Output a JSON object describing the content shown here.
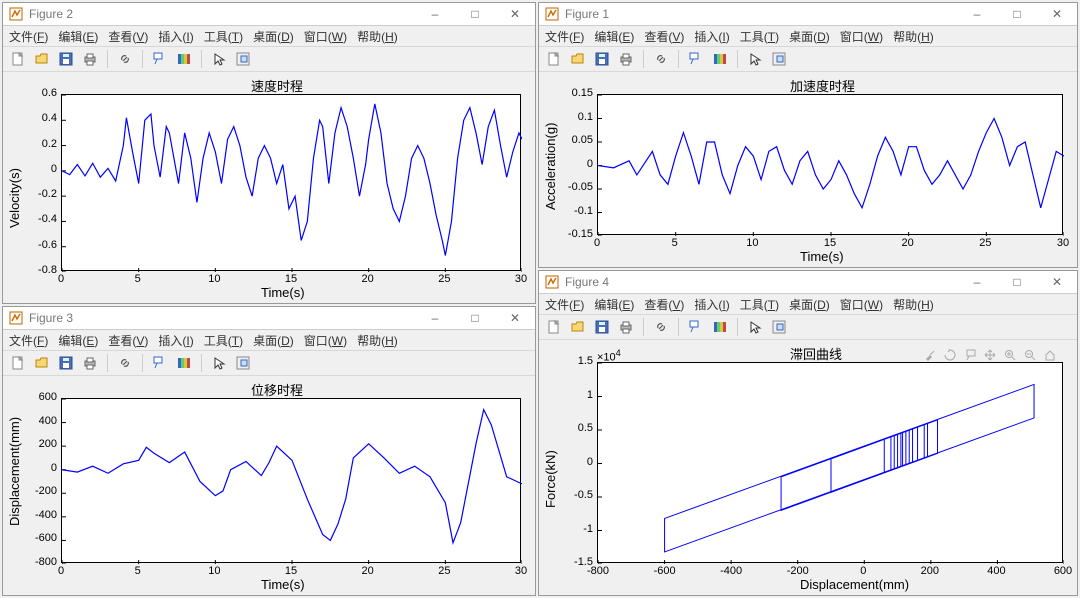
{
  "menus": [
    {
      "label": "文件",
      "ul": "F"
    },
    {
      "label": "编辑",
      "ul": "E"
    },
    {
      "label": "查看",
      "ul": "V"
    },
    {
      "label": "插入",
      "ul": "I"
    },
    {
      "label": "工具",
      "ul": "T"
    },
    {
      "label": "桌面",
      "ul": "D"
    },
    {
      "label": "窗口",
      "ul": "W"
    },
    {
      "label": "帮助",
      "ul": "H"
    }
  ],
  "toolbar_icons": [
    "new",
    "open",
    "save",
    "print",
    "sep",
    "link",
    "sep",
    "datatip",
    "colorbar",
    "sep",
    "pointer",
    "brush"
  ],
  "win_icons": {
    "min": "–",
    "max": "□",
    "close": "✕"
  },
  "axes_toolbar": [
    "brush-icon",
    "rotate-icon",
    "datatip-icon",
    "pan-icon",
    "zoomin-icon",
    "zoomout-icon",
    "home-icon"
  ],
  "figures": {
    "fig1": {
      "window_title": "Figure 1",
      "title": "加速度时程",
      "xlabel": "Time(s)",
      "ylabel": "Acceleration(g)"
    },
    "fig2": {
      "window_title": "Figure 2",
      "title": "速度时程",
      "xlabel": "Time(s)",
      "ylabel": "Velocity(s)"
    },
    "fig3": {
      "window_title": "Figure 3",
      "title": "位移时程",
      "xlabel": "Time(s)",
      "ylabel": "Displacement(mm)"
    },
    "fig4": {
      "window_title": "Figure 4",
      "title": "滞回曲线",
      "xlabel": "Displacement(mm)",
      "ylabel": "Force(kN)",
      "y_exp": "×10",
      "y_exp_sup": "4"
    }
  },
  "chart_data": [
    {
      "id": "fig2",
      "type": "line",
      "title": "速度时程",
      "xlabel": "Time(s)",
      "ylabel": "Velocity(s)",
      "xlim": [
        0,
        30
      ],
      "ylim": [
        -0.8,
        0.6
      ],
      "xticks": [
        0,
        5,
        10,
        15,
        20,
        25,
        30
      ],
      "yticks": [
        -0.8,
        -0.6,
        -0.4,
        -0.2,
        0,
        0.2,
        0.4,
        0.6
      ],
      "series": [
        {
          "name": "velocity",
          "color": "#0000ff",
          "x": [
            0,
            0.5,
            1,
            1.5,
            2,
            2.5,
            3,
            3.5,
            4,
            4.2,
            4.6,
            5,
            5.4,
            5.8,
            6,
            6.4,
            6.8,
            7,
            7.3,
            7.6,
            8,
            8.4,
            8.8,
            9.2,
            9.6,
            10,
            10.4,
            10.8,
            11.2,
            11.6,
            12,
            12.4,
            12.8,
            13.2,
            13.6,
            14,
            14.4,
            14.8,
            15.2,
            15.6,
            16,
            16.4,
            16.8,
            17,
            17.4,
            17.8,
            18.2,
            18.6,
            19,
            19.4,
            19.8,
            20,
            20.4,
            20.8,
            21.2,
            21.6,
            22,
            22.4,
            22.8,
            23.2,
            23.6,
            24,
            24.4,
            24.8,
            25,
            25.4,
            25.8,
            26.2,
            26.6,
            27,
            27.4,
            27.8,
            28.2,
            28.6,
            29,
            29.4,
            29.8,
            30
          ],
          "y": [
            0,
            -0.03,
            0.05,
            -0.04,
            0.06,
            -0.05,
            0.02,
            -0.08,
            0.2,
            0.42,
            0.15,
            -0.1,
            0.4,
            0.45,
            0.2,
            -0.05,
            0.35,
            0.3,
            0.1,
            -0.1,
            0.3,
            0.1,
            -0.25,
            0.1,
            0.3,
            0.15,
            -0.1,
            0.25,
            0.35,
            0.2,
            -0.05,
            -0.2,
            0.1,
            0.2,
            0.1,
            -0.1,
            0.05,
            -0.3,
            -0.2,
            -0.55,
            -0.4,
            0.1,
            0.4,
            0.35,
            -0.1,
            0.3,
            0.5,
            0.35,
            0.1,
            -0.2,
            0.05,
            0.25,
            0.53,
            0.3,
            -0.1,
            -0.3,
            -0.4,
            -0.2,
            0.1,
            0.2,
            0.1,
            -0.1,
            -0.35,
            -0.55,
            -0.67,
            -0.4,
            0.1,
            0.4,
            0.5,
            0.3,
            0.05,
            0.35,
            0.48,
            0.2,
            -0.05,
            0.15,
            0.3,
            0.25
          ]
        }
      ]
    },
    {
      "id": "fig1",
      "type": "line",
      "title": "加速度时程",
      "xlabel": "Time(s)",
      "ylabel": "Acceleration(g)",
      "xlim": [
        0,
        30
      ],
      "ylim": [
        -0.15,
        0.15
      ],
      "xticks": [
        0,
        5,
        10,
        15,
        20,
        25,
        30
      ],
      "yticks": [
        -0.15,
        -0.1,
        -0.05,
        0,
        0.05,
        0.1,
        0.15
      ],
      "series": [
        {
          "name": "acceleration",
          "color": "#0000ff",
          "x": [
            0,
            1,
            2,
            2.5,
            3,
            3.5,
            4,
            4.5,
            5,
            5.5,
            6,
            6.5,
            7,
            7.5,
            8,
            8.5,
            9,
            9.5,
            10,
            10.5,
            11,
            11.5,
            12,
            12.5,
            13,
            13.5,
            14,
            14.5,
            15,
            15.5,
            16,
            16.5,
            17,
            17.5,
            18,
            18.5,
            19,
            19.5,
            20,
            20.5,
            21,
            21.5,
            22,
            22.5,
            23,
            23.5,
            24,
            24.5,
            25,
            25.5,
            26,
            26.5,
            27,
            27.5,
            28,
            28.5,
            29,
            29.5,
            30
          ],
          "y": [
            0,
            -0.005,
            0.01,
            -0.02,
            0.005,
            0.03,
            -0.02,
            -0.04,
            0.02,
            0.07,
            0.02,
            -0.04,
            0.05,
            0.05,
            -0.02,
            -0.06,
            0.0,
            0.04,
            0.02,
            -0.03,
            0.03,
            0.04,
            -0.01,
            -0.04,
            0.01,
            0.03,
            -0.02,
            -0.05,
            -0.03,
            0.01,
            -0.02,
            -0.06,
            -0.09,
            -0.04,
            0.02,
            0.06,
            0.03,
            -0.02,
            0.04,
            0.04,
            -0.01,
            -0.04,
            -0.02,
            0.01,
            -0.02,
            -0.05,
            -0.02,
            0.03,
            0.07,
            0.1,
            0.06,
            0.0,
            0.04,
            0.05,
            -0.02,
            -0.09,
            -0.03,
            0.03,
            0.02
          ]
        }
      ]
    },
    {
      "id": "fig3",
      "type": "line",
      "title": "位移时程",
      "xlabel": "Time(s)",
      "ylabel": "Displacement(mm)",
      "xlim": [
        0,
        30
      ],
      "ylim": [
        -800,
        600
      ],
      "xticks": [
        0,
        5,
        10,
        15,
        20,
        25,
        30
      ],
      "yticks": [
        -800,
        -600,
        -400,
        -200,
        0,
        200,
        400,
        600
      ],
      "series": [
        {
          "name": "displacement",
          "color": "#0000ff",
          "x": [
            0,
            1,
            2,
            3,
            4,
            5,
            5.5,
            6,
            7,
            8,
            9,
            10,
            10.5,
            11,
            12,
            13,
            13.5,
            14,
            15,
            16,
            17,
            17.5,
            18,
            18.5,
            19,
            20,
            21,
            22,
            23,
            24,
            25,
            25.5,
            26,
            27,
            27.5,
            28,
            29,
            30
          ],
          "y": [
            0,
            -20,
            30,
            -30,
            50,
            80,
            190,
            140,
            60,
            150,
            -100,
            -220,
            -180,
            0,
            70,
            -50,
            60,
            200,
            80,
            -250,
            -550,
            -600,
            -460,
            -250,
            100,
            220,
            100,
            -30,
            30,
            -60,
            -280,
            -620,
            -450,
            220,
            510,
            380,
            -60,
            -120
          ]
        }
      ]
    },
    {
      "id": "fig4",
      "type": "line",
      "title": "滞回曲线",
      "xlabel": "Displacement(mm)",
      "ylabel": "Force(kN)",
      "y_exponent": 4,
      "xlim": [
        -800,
        600
      ],
      "ylim": [
        -1.5,
        1.5
      ],
      "xticks": [
        -800,
        -600,
        -400,
        -200,
        0,
        200,
        400,
        600
      ],
      "yticks": [
        -1.5,
        -1,
        -0.5,
        0,
        0.5,
        1,
        1.5
      ],
      "series": [
        {
          "name": "hysteresis",
          "color": "#0000ff",
          "loops": [
            {
              "d1": -600,
              "d2": 510,
              "f_bot_at_d1": -1.32,
              "f_top_at_d1": -0.82,
              "f_bot_at_d2": 0.68,
              "f_top_at_d2": 1.18
            },
            {
              "d1": -250,
              "d2": 220,
              "f_bot_at_d1": -0.7,
              "f_top_at_d1": -0.2,
              "f_bot_at_d2": 0.15,
              "f_top_at_d2": 0.65
            },
            {
              "d1": -100,
              "d2": 190,
              "f_bot_at_d1": -0.43,
              "f_top_at_d1": 0.07,
              "f_bot_at_d2": 0.1,
              "f_top_at_d2": 0.6
            }
          ],
          "inner_lines": [
            60,
            80,
            90,
            100,
            110,
            115,
            125,
            135,
            145,
            160,
            180
          ]
        }
      ]
    }
  ]
}
